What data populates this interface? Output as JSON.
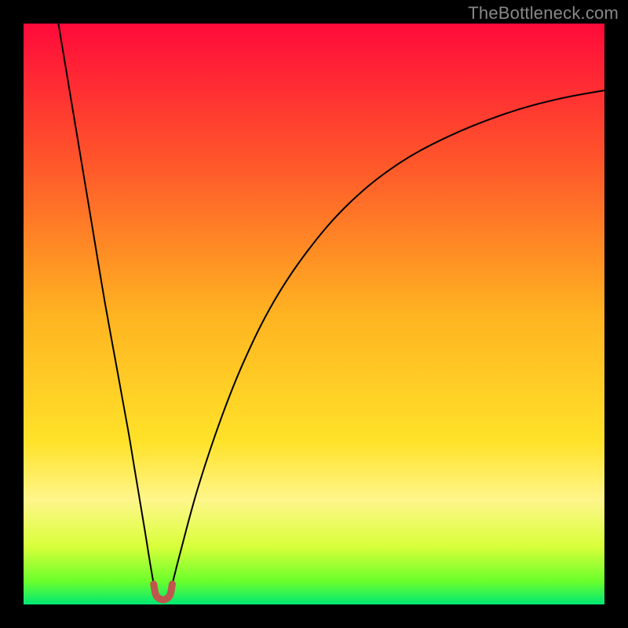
{
  "watermark": {
    "text": "TheBottleneck.com"
  },
  "chart_data": {
    "type": "line",
    "title": "",
    "xlabel": "",
    "ylabel": "",
    "xlim": [
      0,
      100
    ],
    "ylim": [
      0,
      100
    ],
    "grid": false,
    "legend": false,
    "background_gradient": {
      "type": "vertical",
      "stops": [
        {
          "offset": 0.0,
          "color": "#ff0a3a"
        },
        {
          "offset": 0.25,
          "color": "#ff5a2a"
        },
        {
          "offset": 0.5,
          "color": "#ffb321"
        },
        {
          "offset": 0.72,
          "color": "#ffe229"
        },
        {
          "offset": 0.82,
          "color": "#fff68b"
        },
        {
          "offset": 0.9,
          "color": "#d9ff3a"
        },
        {
          "offset": 0.96,
          "color": "#6bff2c"
        },
        {
          "offset": 1.0,
          "color": "#00e874"
        }
      ]
    },
    "series": [
      {
        "name": "left-branch",
        "color": "#000000",
        "width": 2,
        "points": [
          {
            "x": 6.0,
            "y": 100.0
          },
          {
            "x": 8.0,
            "y": 88.0
          },
          {
            "x": 10.0,
            "y": 76.0
          },
          {
            "x": 12.0,
            "y": 64.0
          },
          {
            "x": 14.0,
            "y": 52.0
          },
          {
            "x": 16.0,
            "y": 41.0
          },
          {
            "x": 18.0,
            "y": 30.0
          },
          {
            "x": 19.0,
            "y": 24.0
          },
          {
            "x": 20.0,
            "y": 18.0
          },
          {
            "x": 21.0,
            "y": 12.0
          },
          {
            "x": 21.8,
            "y": 7.0
          },
          {
            "x": 22.4,
            "y": 3.5
          }
        ]
      },
      {
        "name": "right-branch",
        "color": "#000000",
        "width": 2,
        "points": [
          {
            "x": 25.6,
            "y": 3.5
          },
          {
            "x": 27.0,
            "y": 9.0
          },
          {
            "x": 30.0,
            "y": 20.0
          },
          {
            "x": 34.0,
            "y": 32.0
          },
          {
            "x": 38.0,
            "y": 42.0
          },
          {
            "x": 43.0,
            "y": 52.0
          },
          {
            "x": 49.0,
            "y": 61.0
          },
          {
            "x": 56.0,
            "y": 69.0
          },
          {
            "x": 64.0,
            "y": 75.5
          },
          {
            "x": 73.0,
            "y": 80.5
          },
          {
            "x": 83.0,
            "y": 84.5
          },
          {
            "x": 92.0,
            "y": 87.0
          },
          {
            "x": 100.0,
            "y": 88.5
          }
        ]
      }
    ],
    "trough_marker": {
      "color": "#c0554e",
      "width": 9,
      "points": [
        {
          "x": 22.4,
          "y": 3.5
        },
        {
          "x": 22.8,
          "y": 1.6
        },
        {
          "x": 23.6,
          "y": 0.9
        },
        {
          "x": 24.4,
          "y": 0.9
        },
        {
          "x": 25.2,
          "y": 1.6
        },
        {
          "x": 25.6,
          "y": 3.5
        }
      ]
    }
  }
}
